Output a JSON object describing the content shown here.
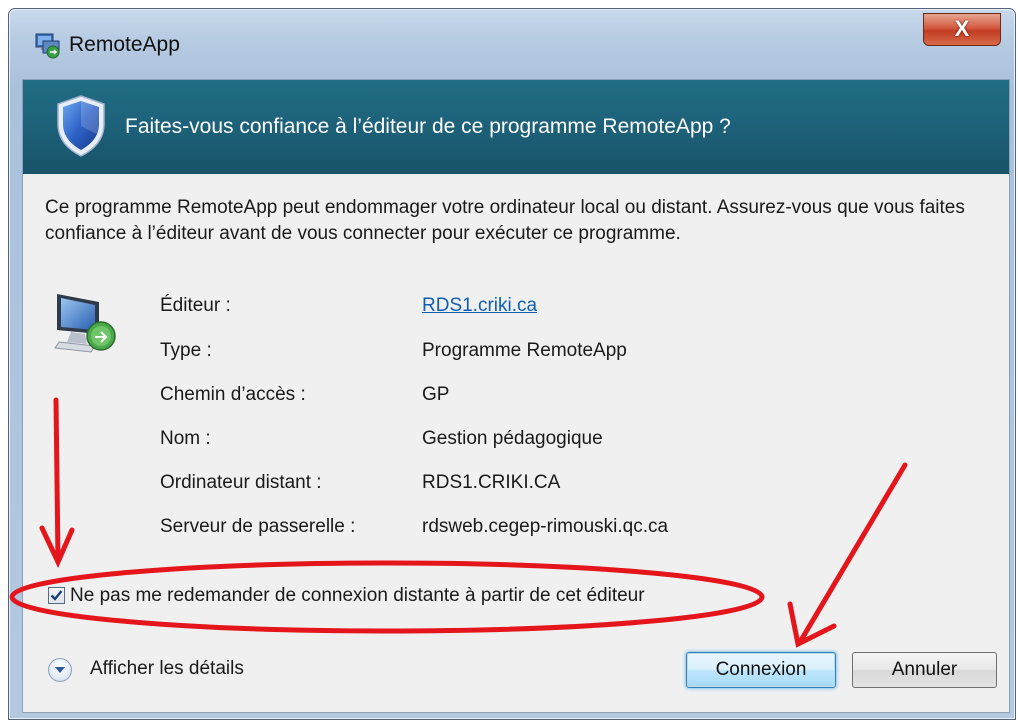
{
  "window": {
    "title": "RemoteApp",
    "close_glyph": "X"
  },
  "header": {
    "title": "Faites-vous confiance à l’éditeur de ce programme RemoteApp ?",
    "icon": "shield-icon"
  },
  "description": "Ce programme RemoteApp peut endommager votre ordinateur local ou distant. Assurez-vous que vous faites confiance à l’éditeur avant de vous connecter pour exécuter ce programme.",
  "details": [
    {
      "label": "Éditeur :",
      "value": "RDS1.criki.ca",
      "is_link": true
    },
    {
      "label": "Type :",
      "value": "Programme RemoteApp"
    },
    {
      "label": "Chemin d’accès :",
      "value": "GP"
    },
    {
      "label": "Nom :",
      "value": "Gestion pédagogique"
    },
    {
      "label": "Ordinateur distant :",
      "value": "RDS1.CRIKI.CA"
    },
    {
      "label": "Serveur de passerelle :",
      "value": "rdsweb.cegep-rimouski.qc.ca"
    }
  ],
  "checkbox": {
    "label": "Ne pas me redemander de connexion distante à partir de cet éditeur",
    "checked": true
  },
  "footer": {
    "details_toggle_label": "Afficher les détails",
    "connect_label": "Connexion",
    "cancel_label": "Annuler"
  },
  "colors": {
    "header_bg": "#1d6179",
    "link": "#0f5fb0",
    "annotation_red": "#e4161c"
  }
}
